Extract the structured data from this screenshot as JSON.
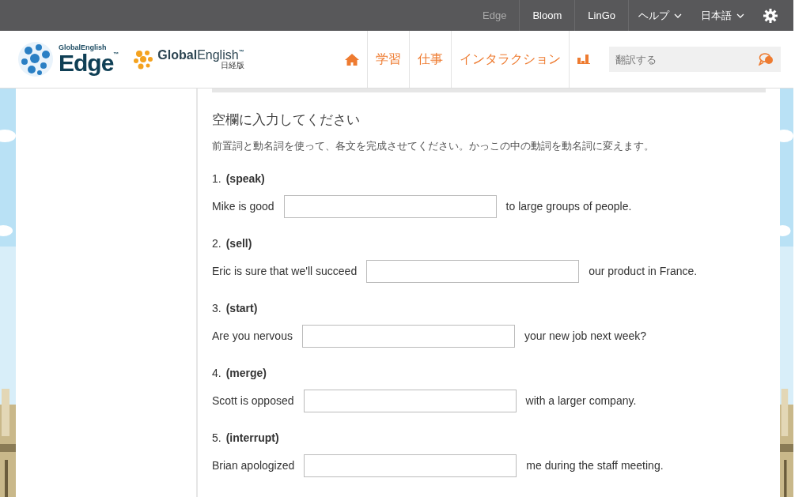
{
  "top_bar": {
    "products": [
      {
        "label": "Edge",
        "selected": true
      },
      {
        "label": "Bloom",
        "selected": false
      },
      {
        "label": "LinGo",
        "selected": false
      }
    ],
    "menus": [
      {
        "label": "ヘルプ"
      },
      {
        "label": "日本語"
      }
    ]
  },
  "header": {
    "logo_edge": {
      "brand": "GlobalEnglish",
      "name": "Edge",
      "mark": "™"
    },
    "logo_global": {
      "name_bold": "Global",
      "name_light": "English",
      "mark": "™",
      "edition": "日経版"
    },
    "nav": [
      {
        "kind": "home"
      },
      {
        "kind": "text",
        "label": "学習"
      },
      {
        "kind": "text",
        "label": "仕事"
      },
      {
        "kind": "text",
        "label": "インタラクション"
      },
      {
        "kind": "chart"
      }
    ],
    "translate": {
      "placeholder": "翻訳する"
    }
  },
  "exercise": {
    "title": "空欄に入力してください",
    "instruction": "前置詞と動名詞を使って、各文を完成させてください。かっこの中の動詞を動名詞に変えます。",
    "items": [
      {
        "number": "1.",
        "verb": "(speak)",
        "before": "Mike is good",
        "after": "to large groups of people."
      },
      {
        "number": "2.",
        "verb": "(sell)",
        "before": "Eric is sure that we'll succeed",
        "after": "our product in France."
      },
      {
        "number": "3.",
        "verb": "(start)",
        "before": "Are you nervous",
        "after": "your new job next week?"
      },
      {
        "number": "4.",
        "verb": "(merge)",
        "before": "Scott is opposed",
        "after": "with a larger company."
      },
      {
        "number": "5.",
        "verb": "(interrupt)",
        "before": "Brian apologized",
        "after": "me during the staff meeting."
      }
    ]
  }
}
